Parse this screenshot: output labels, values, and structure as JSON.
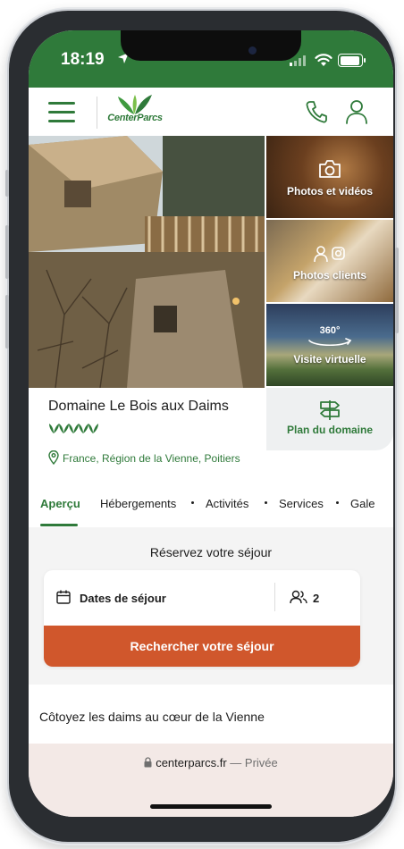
{
  "status_bar": {
    "time": "18:19",
    "icons": [
      "location-arrow-icon",
      "cellular-signal-icon",
      "wifi-icon",
      "battery-icon"
    ]
  },
  "header": {
    "logo_text": "CenterParcs",
    "icons": [
      "hamburger-menu-icon",
      "phone-icon",
      "user-icon"
    ],
    "brand_color": "#2f7a3a"
  },
  "gallery": {
    "thumbnails": [
      {
        "label": "Photos et vidéos",
        "icon": "camera-icon"
      },
      {
        "label": "Photos clients",
        "icon": "user-instagram-icon"
      },
      {
        "label": "Visite virtuelle",
        "icon": "360-icon",
        "badge": "360°"
      }
    ]
  },
  "domain": {
    "title": "Domaine Le Bois aux Daims",
    "rating_icons": 5,
    "location": "France, Région de la Vienne, Poitiers",
    "plan_label": "Plan du domaine"
  },
  "tabs": [
    {
      "label": "Aperçu",
      "active": true
    },
    {
      "label": "Hébergements",
      "active": false
    },
    {
      "label": "Activités",
      "active": false
    },
    {
      "label": "Services",
      "active": false
    },
    {
      "label": "Gale",
      "active": false
    }
  ],
  "booking": {
    "title": "Réservez votre séjour",
    "dates_label": "Dates de séjour",
    "guests_count": "2",
    "search_button": "Rechercher votre séjour",
    "button_color": "#d0572c"
  },
  "description": {
    "heading": "Côtoyez les daims au cœur de la Vienne"
  },
  "browser": {
    "domain": "centerparcs.fr",
    "separator": " — ",
    "mode": "Privée"
  }
}
